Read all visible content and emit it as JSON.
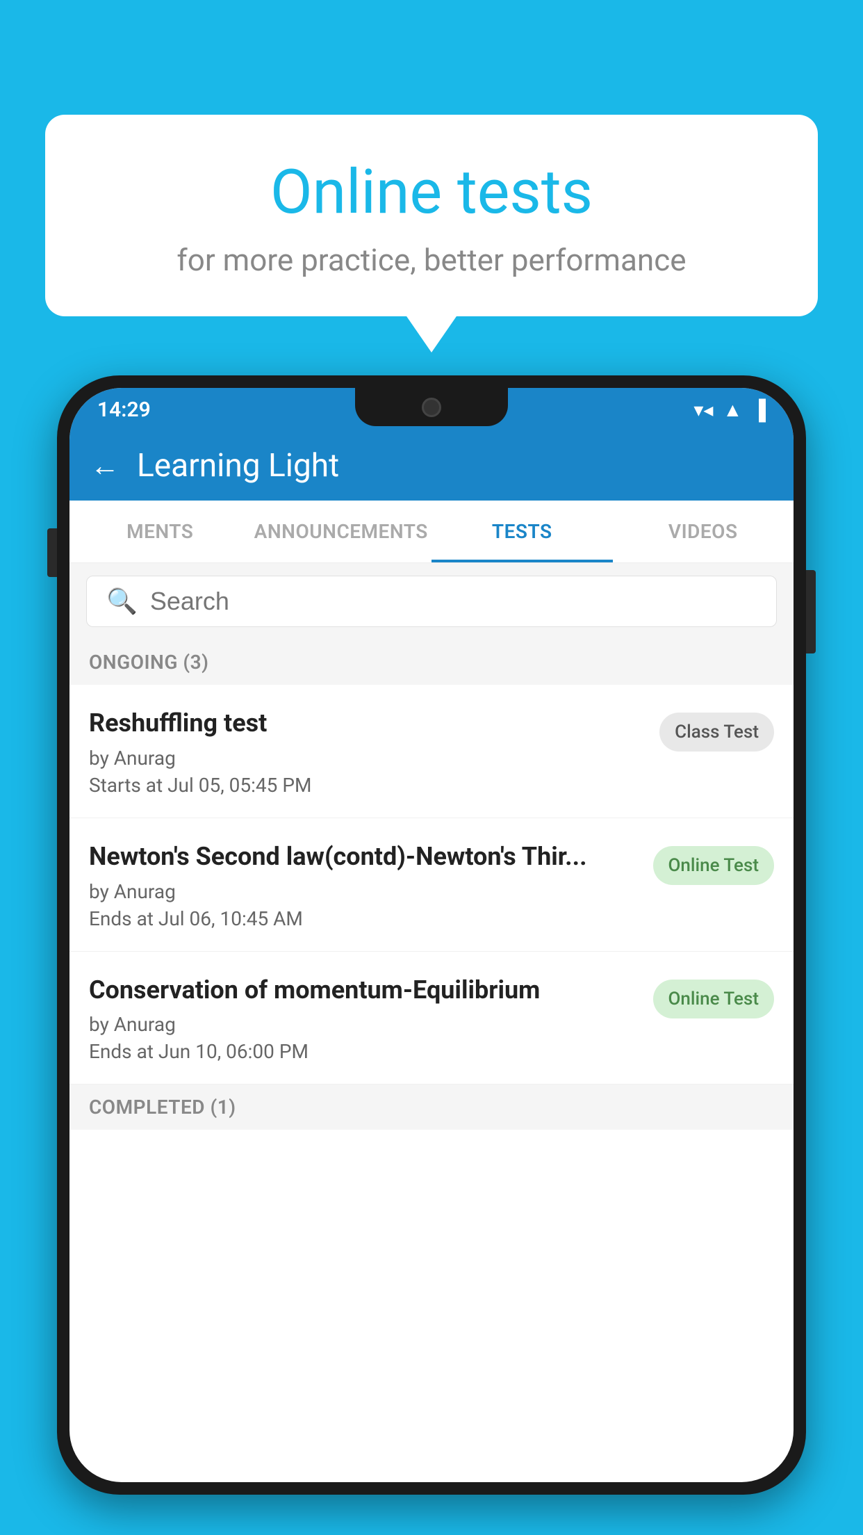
{
  "background_color": "#1ab8e8",
  "bubble": {
    "title": "Online tests",
    "subtitle": "for more practice, better performance"
  },
  "phone": {
    "status_bar": {
      "time": "14:29",
      "icons": [
        "wifi",
        "signal",
        "battery"
      ]
    },
    "header": {
      "back_label": "←",
      "title": "Learning Light"
    },
    "tabs": [
      {
        "label": "MENTS",
        "active": false
      },
      {
        "label": "ANNOUNCEMENTS",
        "active": false
      },
      {
        "label": "TESTS",
        "active": true
      },
      {
        "label": "VIDEOS",
        "active": false
      }
    ],
    "search": {
      "placeholder": "Search"
    },
    "ongoing_section": {
      "header": "ONGOING (3)",
      "items": [
        {
          "name": "Reshuffling test",
          "author": "by Anurag",
          "date_label": "Starts at",
          "date": "Jul 05, 05:45 PM",
          "badge": "Class Test",
          "badge_type": "class"
        },
        {
          "name": "Newton's Second law(contd)-Newton's Thir...",
          "author": "by Anurag",
          "date_label": "Ends at",
          "date": "Jul 06, 10:45 AM",
          "badge": "Online Test",
          "badge_type": "online"
        },
        {
          "name": "Conservation of momentum-Equilibrium",
          "author": "by Anurag",
          "date_label": "Ends at",
          "date": "Jun 10, 06:00 PM",
          "badge": "Online Test",
          "badge_type": "online"
        }
      ]
    },
    "completed_section": {
      "header": "COMPLETED (1)"
    }
  }
}
